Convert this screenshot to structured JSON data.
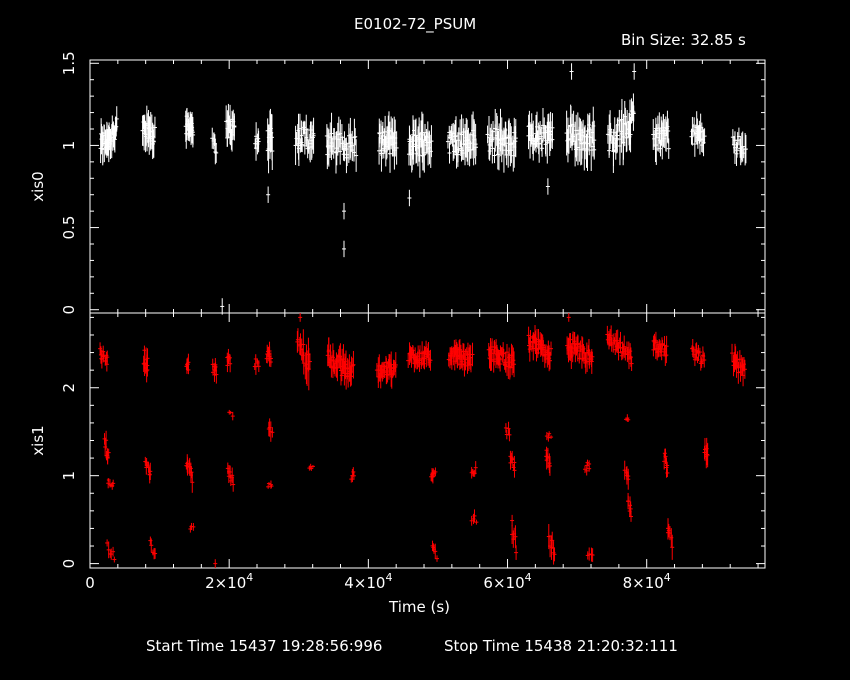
{
  "chart_data": [
    {
      "type": "scatter",
      "panel": "top",
      "title": "E0102-72_PSUM",
      "bin_size_label": "Bin Size: 32.85 s",
      "ylabel": "xis0",
      "xlabel": "",
      "xlim": [
        0,
        97000
      ],
      "ylim": [
        -0.02,
        1.52
      ],
      "yticks": [
        0,
        0.5,
        1,
        1.5
      ],
      "ytick_labels": [
        "0",
        "0.5",
        "1",
        "1.5"
      ],
      "color": "#ffffff",
      "series": [
        {
          "clusters": [
            {
              "x0": 1500,
              "x1": 3800,
              "center": 1.05,
              "spread": 0.12,
              "points": 32,
              "slope": 0.2
            },
            {
              "x0": 7600,
              "x1": 9300,
              "center": 1.08,
              "spread": 0.12,
              "points": 24,
              "slope": 0.0
            },
            {
              "x0": 13800,
              "x1": 14800,
              "center": 1.12,
              "spread": 0.1,
              "points": 18,
              "slope": 0.0
            },
            {
              "x0": 17600,
              "x1": 18100,
              "center": 1.0,
              "spread": 0.08,
              "points": 6,
              "slope": 0.0
            },
            {
              "x0": 19600,
              "x1": 20800,
              "center": 1.1,
              "spread": 0.12,
              "points": 16,
              "slope": 0.0
            },
            {
              "x0": 23700,
              "x1": 24200,
              "center": 1.02,
              "spread": 0.1,
              "points": 6,
              "slope": 0.0
            },
            {
              "x0": 25500,
              "x1": 26200,
              "center": 1.05,
              "spread": 0.15,
              "points": 10,
              "slope": 0.0
            },
            {
              "x0": 29600,
              "x1": 32200,
              "center": 1.05,
              "spread": 0.12,
              "points": 28,
              "slope": 0.0
            },
            {
              "x0": 34000,
              "x1": 38200,
              "center": 1.0,
              "spread": 0.13,
              "points": 40,
              "slope": 0.0
            },
            {
              "x0": 41500,
              "x1": 44000,
              "center": 1.02,
              "spread": 0.12,
              "points": 30,
              "slope": 0.0
            },
            {
              "x0": 45800,
              "x1": 49000,
              "center": 1.02,
              "spread": 0.14,
              "points": 36,
              "slope": 0.0
            },
            {
              "x0": 51500,
              "x1": 55500,
              "center": 1.02,
              "spread": 0.13,
              "points": 42,
              "slope": 0.0
            },
            {
              "x0": 57200,
              "x1": 61200,
              "center": 1.02,
              "spread": 0.14,
              "points": 42,
              "slope": 0.0
            },
            {
              "x0": 63000,
              "x1": 66500,
              "center": 1.05,
              "spread": 0.13,
              "points": 38,
              "slope": 0.0
            },
            {
              "x0": 68500,
              "x1": 72500,
              "center": 1.05,
              "spread": 0.14,
              "points": 44,
              "slope": 0.0
            },
            {
              "x0": 74500,
              "x1": 78200,
              "center": 1.08,
              "spread": 0.14,
              "points": 40,
              "slope": 0.3
            },
            {
              "x0": 81000,
              "x1": 83200,
              "center": 1.05,
              "spread": 0.12,
              "points": 24,
              "slope": 0.0
            },
            {
              "x0": 86500,
              "x1": 88300,
              "center": 1.06,
              "spread": 0.1,
              "points": 18,
              "slope": 0.0
            },
            {
              "x0": 92400,
              "x1": 94200,
              "center": 1.0,
              "spread": 0.1,
              "points": 16,
              "slope": 0.0
            }
          ],
          "outliers": [
            {
              "x": 36500,
              "y": 0.37
            },
            {
              "x": 36500,
              "y": 0.6
            },
            {
              "x": 25600,
              "y": 0.7
            },
            {
              "x": 45900,
              "y": 0.68
            },
            {
              "x": 19000,
              "y": 0.02
            },
            {
              "x": 65800,
              "y": 0.75
            },
            {
              "x": 69200,
              "y": 1.45
            },
            {
              "x": 78200,
              "y": 1.45
            }
          ]
        }
      ]
    },
    {
      "type": "scatter",
      "panel": "bottom",
      "ylabel": "xis1",
      "xlabel": "Time (s)",
      "xlim": [
        0,
        97000
      ],
      "ylim": [
        -0.05,
        2.85
      ],
      "yticks": [
        0,
        1,
        2
      ],
      "ytick_labels": [
        "0",
        "1",
        "2"
      ],
      "xticks": [
        0,
        20000,
        40000,
        60000,
        80000
      ],
      "xtick_labels": [
        [
          "0",
          ""
        ],
        [
          "2×10",
          "4"
        ],
        [
          "4×10",
          "4"
        ],
        [
          "6×10",
          "4"
        ],
        [
          "8×10",
          "4"
        ]
      ],
      "color": "#ff0000",
      "series": [
        {
          "clusters": [
            {
              "x0": 1500,
              "x1": 2500,
              "center": 2.35,
              "spread": 0.12,
              "points": 12,
              "slope": -0.3
            },
            {
              "x0": 7700,
              "x1": 8300,
              "center": 2.3,
              "spread": 0.15,
              "points": 10,
              "slope": -0.3
            },
            {
              "x0": 13800,
              "x1": 14200,
              "center": 2.25,
              "spread": 0.1,
              "points": 6,
              "slope": 0.0
            },
            {
              "x0": 17600,
              "x1": 18200,
              "center": 2.2,
              "spread": 0.12,
              "points": 8,
              "slope": 0.0
            },
            {
              "x0": 19700,
              "x1": 20200,
              "center": 2.3,
              "spread": 0.1,
              "points": 6,
              "slope": 0.0
            },
            {
              "x0": 23700,
              "x1": 24200,
              "center": 2.3,
              "spread": 0.1,
              "points": 6,
              "slope": 0.0
            },
            {
              "x0": 25400,
              "x1": 26000,
              "center": 2.35,
              "spread": 0.12,
              "points": 8,
              "slope": 0.0
            },
            {
              "x0": 29800,
              "x1": 31600,
              "center": 2.4,
              "spread": 0.25,
              "points": 14,
              "slope": -0.3
            },
            {
              "x0": 34200,
              "x1": 37800,
              "center": 2.25,
              "spread": 0.18,
              "points": 40,
              "slope": -0.4
            },
            {
              "x0": 41300,
              "x1": 43900,
              "center": 2.2,
              "spread": 0.15,
              "points": 34,
              "slope": 0.0
            },
            {
              "x0": 45800,
              "x1": 48900,
              "center": 2.35,
              "spread": 0.14,
              "points": 36,
              "slope": -0.1
            },
            {
              "x0": 51600,
              "x1": 54900,
              "center": 2.35,
              "spread": 0.14,
              "points": 38,
              "slope": -0.2
            },
            {
              "x0": 57300,
              "x1": 60900,
              "center": 2.35,
              "spread": 0.15,
              "points": 40,
              "slope": -0.3
            },
            {
              "x0": 63000,
              "x1": 66200,
              "center": 2.45,
              "spread": 0.15,
              "points": 36,
              "slope": -0.4
            },
            {
              "x0": 68600,
              "x1": 72200,
              "center": 2.4,
              "spread": 0.16,
              "points": 40,
              "slope": -0.4
            },
            {
              "x0": 74300,
              "x1": 77800,
              "center": 2.45,
              "spread": 0.13,
              "points": 36,
              "slope": -0.5
            },
            {
              "x0": 80900,
              "x1": 82900,
              "center": 2.45,
              "spread": 0.12,
              "points": 22,
              "slope": -0.2
            },
            {
              "x0": 86500,
              "x1": 88200,
              "center": 2.35,
              "spread": 0.12,
              "points": 18,
              "slope": -0.2
            },
            {
              "x0": 92300,
              "x1": 94100,
              "center": 2.25,
              "spread": 0.15,
              "points": 18,
              "slope": -0.3
            },
            {
              "x0": 2100,
              "x1": 2700,
              "center": 1.3,
              "spread": 0.15,
              "points": 8,
              "slope": -0.6
            },
            {
              "x0": 2600,
              "x1": 3300,
              "center": 0.92,
              "spread": 0.06,
              "points": 6,
              "slope": 0.0
            },
            {
              "x0": 8000,
              "x1": 8700,
              "center": 1.1,
              "spread": 0.1,
              "points": 8,
              "slope": -0.3
            },
            {
              "x0": 13900,
              "x1": 14700,
              "center": 1.05,
              "spread": 0.12,
              "points": 10,
              "slope": -0.4
            },
            {
              "x0": 19800,
              "x1": 20600,
              "center": 1.0,
              "spread": 0.1,
              "points": 8,
              "slope": -0.3
            },
            {
              "x0": 25600,
              "x1": 26100,
              "center": 0.9,
              "spread": 0.05,
              "points": 4,
              "slope": 0.0
            },
            {
              "x0": 31500,
              "x1": 32000,
              "center": 1.1,
              "spread": 0.05,
              "points": 4,
              "slope": 0.0
            },
            {
              "x0": 37500,
              "x1": 38000,
              "center": 1.0,
              "spread": 0.08,
              "points": 4,
              "slope": 0.0
            },
            {
              "x0": 49000,
              "x1": 49600,
              "center": 1.0,
              "spread": 0.08,
              "points": 6,
              "slope": 0.0
            },
            {
              "x0": 54800,
              "x1": 55400,
              "center": 1.05,
              "spread": 0.08,
              "points": 6,
              "slope": 0.0
            },
            {
              "x0": 60400,
              "x1": 61000,
              "center": 1.15,
              "spread": 0.1,
              "points": 8,
              "slope": -0.3
            },
            {
              "x0": 65500,
              "x1": 66100,
              "center": 1.2,
              "spread": 0.12,
              "points": 8,
              "slope": -0.3
            },
            {
              "x0": 71200,
              "x1": 71800,
              "center": 1.1,
              "spread": 0.1,
              "points": 6,
              "slope": 0.0
            },
            {
              "x0": 76900,
              "x1": 77400,
              "center": 1.05,
              "spread": 0.12,
              "points": 6,
              "slope": -0.3
            },
            {
              "x0": 82500,
              "x1": 83000,
              "center": 1.15,
              "spread": 0.12,
              "points": 6,
              "slope": -0.3
            },
            {
              "x0": 88300,
              "x1": 88800,
              "center": 1.25,
              "spread": 0.15,
              "points": 6,
              "slope": -0.4
            },
            {
              "x0": 59800,
              "x1": 60300,
              "center": 1.5,
              "spread": 0.08,
              "points": 4,
              "slope": 0.0
            },
            {
              "x0": 65700,
              "x1": 66200,
              "center": 1.45,
              "spread": 0.05,
              "points": 4,
              "slope": 0.0
            },
            {
              "x0": 77000,
              "x1": 77400,
              "center": 1.65,
              "spread": 0.05,
              "points": 3,
              "slope": 0.0
            },
            {
              "x0": 20000,
              "x1": 20500,
              "center": 1.7,
              "spread": 0.05,
              "points": 3,
              "slope": 0.0
            },
            {
              "x0": 25700,
              "x1": 26200,
              "center": 1.55,
              "spread": 0.12,
              "points": 4,
              "slope": 0.0
            },
            {
              "x0": 2500,
              "x1": 3500,
              "center": 0.15,
              "spread": 0.1,
              "points": 6,
              "slope": -0.5
            },
            {
              "x0": 8700,
              "x1": 9400,
              "center": 0.15,
              "spread": 0.08,
              "points": 5,
              "slope": -0.4
            },
            {
              "x0": 14400,
              "x1": 14800,
              "center": 0.4,
              "spread": 0.05,
              "points": 3,
              "slope": 0.0
            },
            {
              "x0": 49200,
              "x1": 49800,
              "center": 0.15,
              "spread": 0.1,
              "points": 5,
              "slope": -0.4
            },
            {
              "x0": 54900,
              "x1": 55500,
              "center": 0.5,
              "spread": 0.08,
              "points": 4,
              "slope": 0.0
            },
            {
              "x0": 60600,
              "x1": 61200,
              "center": 0.3,
              "spread": 0.15,
              "points": 6,
              "slope": -0.5
            },
            {
              "x0": 66000,
              "x1": 66800,
              "center": 0.2,
              "spread": 0.15,
              "points": 6,
              "slope": -0.4
            },
            {
              "x0": 71600,
              "x1": 72200,
              "center": 0.1,
              "spread": 0.08,
              "points": 4,
              "slope": 0.0
            },
            {
              "x0": 77300,
              "x1": 77800,
              "center": 0.65,
              "spread": 0.12,
              "points": 6,
              "slope": -0.3
            },
            {
              "x0": 83000,
              "x1": 83600,
              "center": 0.3,
              "spread": 0.15,
              "points": 6,
              "slope": -0.4
            }
          ],
          "outliers": [
            {
              "x": 30200,
              "y": 2.8
            },
            {
              "x": 68800,
              "y": 2.8
            },
            {
              "x": 18000,
              "y": 0.0
            }
          ]
        }
      ]
    }
  ],
  "footer": {
    "start_time": "Start Time 15437 19:28:56:996",
    "stop_time": "Stop Time 15438 21:20:32:111"
  }
}
